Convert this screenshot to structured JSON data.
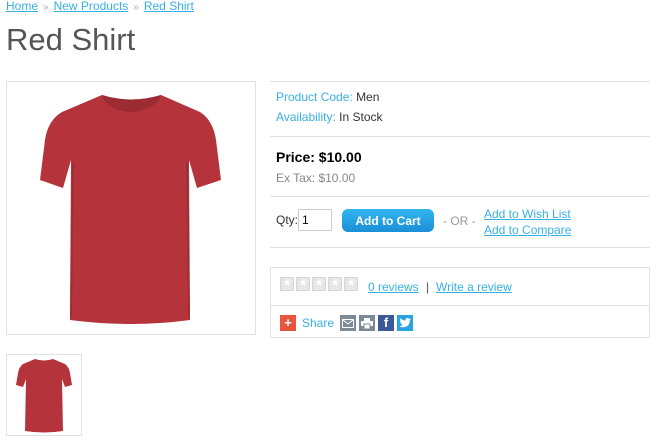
{
  "breadcrumb": {
    "items": [
      "Home",
      "New Products",
      "Red Shirt"
    ],
    "separator": "»"
  },
  "product": {
    "title": "Red Shirt",
    "image_alt": "red-tshirt-image",
    "code_label": "Product Code:",
    "code_value": "Men",
    "availability_label": "Availability:",
    "availability_value": "In Stock",
    "price": "Price: $10.00",
    "ex_tax": "Ex Tax: $10.00"
  },
  "purchase": {
    "qty_label": "Qty:",
    "qty_value": "1",
    "add_to_cart_label": "Add to Cart",
    "or_label": "- OR -",
    "wishlist_label": "Add to Wish List",
    "compare_label": "Add to Compare"
  },
  "reviews": {
    "rating": 0,
    "max_rating": 5,
    "count_label": "0 reviews",
    "divider": "|",
    "write_label": "Write a review"
  },
  "share": {
    "label": "Share",
    "buttons": [
      "email-icon",
      "print-icon",
      "facebook-icon",
      "twitter-icon"
    ]
  },
  "colors": {
    "link": "#38b0e3",
    "button": "#1a8fd6",
    "shirt": "#b5343c",
    "share": "#e8553e",
    "facebook": "#3b5998",
    "twitter": "#2aa3e6"
  }
}
